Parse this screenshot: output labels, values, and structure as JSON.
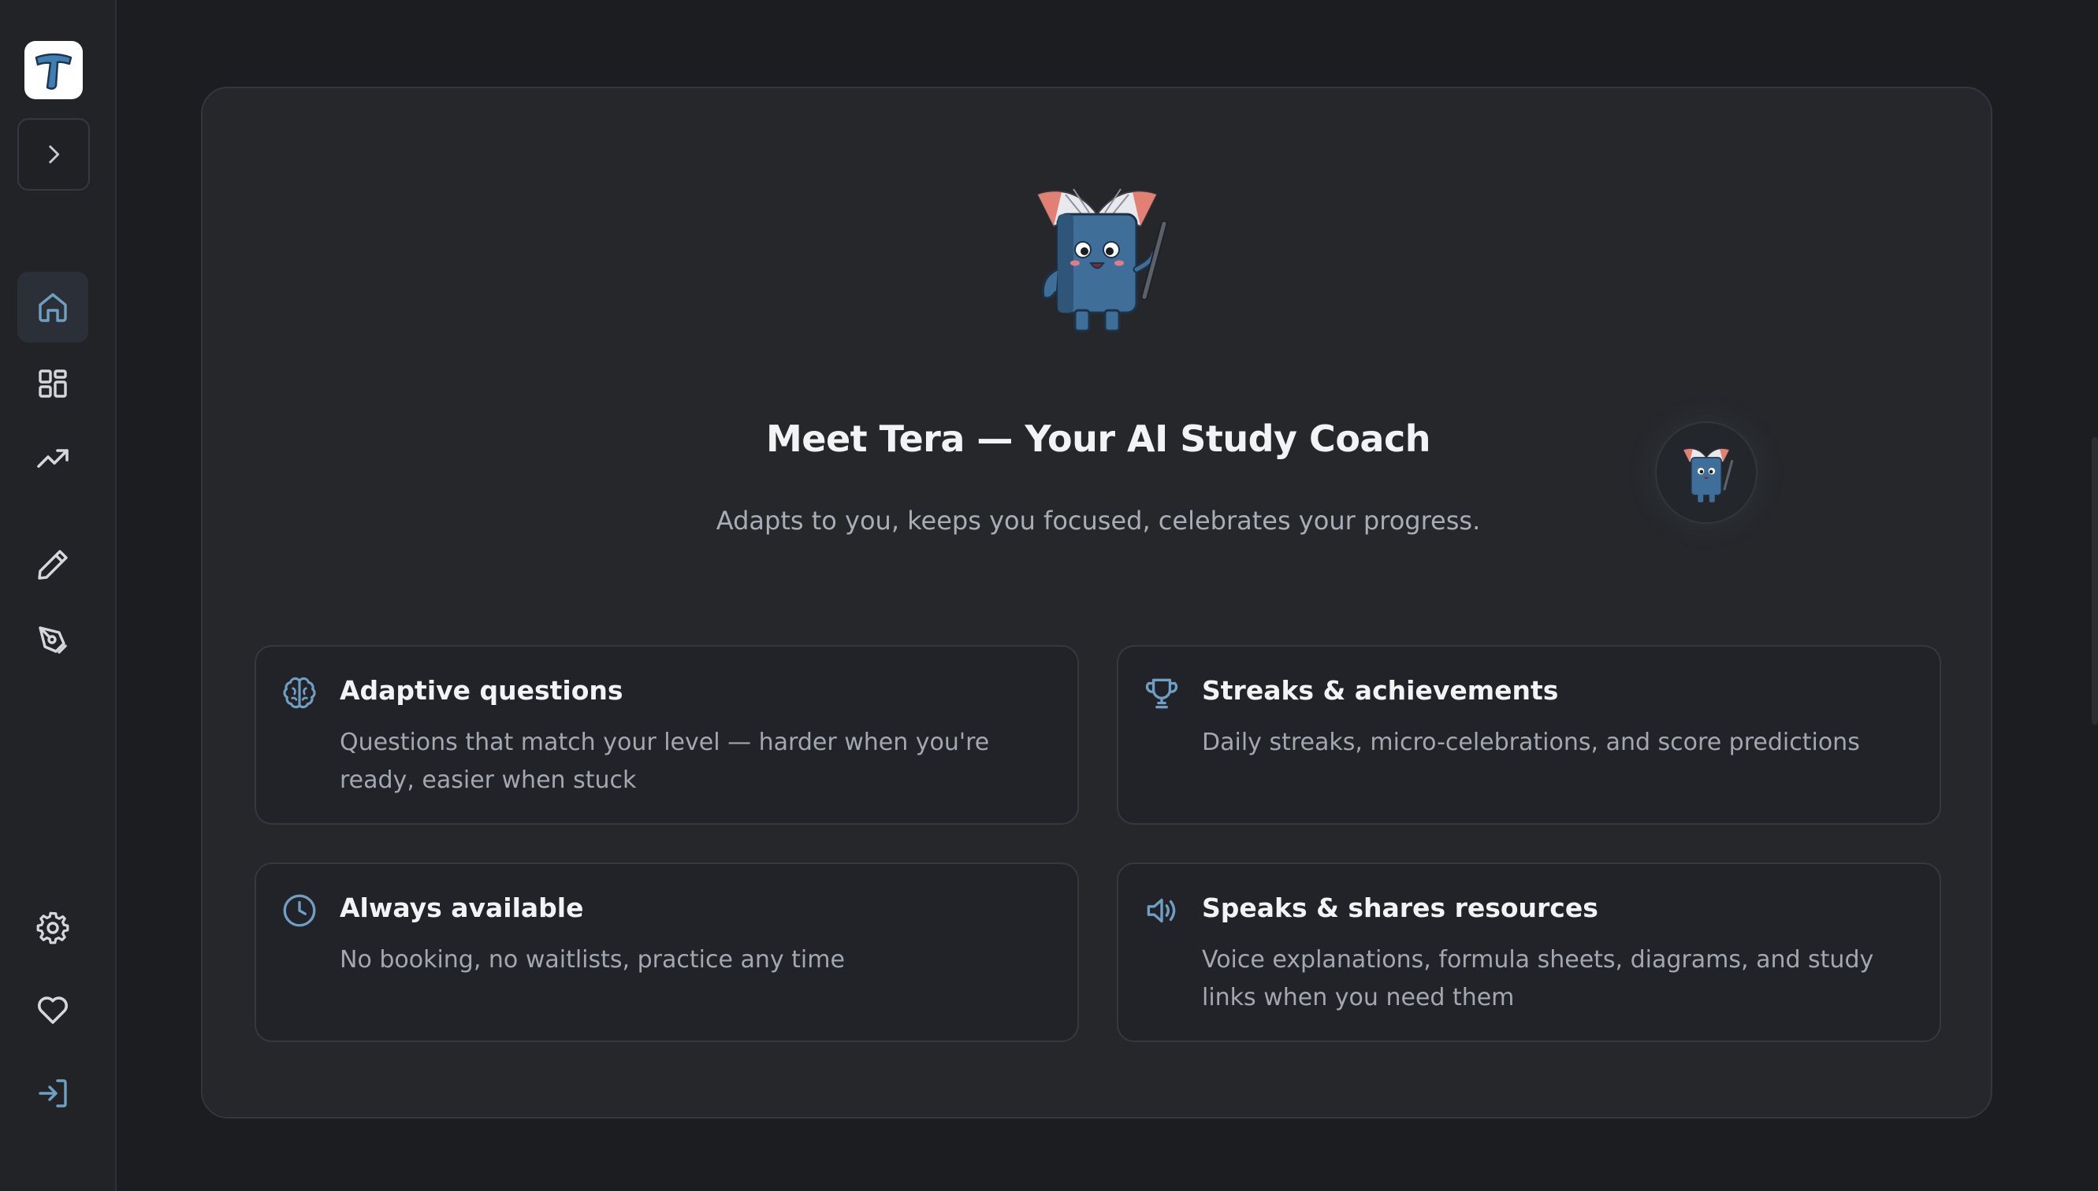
{
  "sidebar": {
    "logo_letter": "T",
    "toggle_icon": "chevron-right-icon",
    "nav": [
      {
        "id": "home",
        "icon": "home-icon",
        "active": true
      },
      {
        "id": "dashboard",
        "icon": "grid-icon",
        "active": false
      },
      {
        "id": "progress",
        "icon": "trending-up-icon",
        "active": false
      },
      {
        "id": "practice",
        "icon": "pencil-icon",
        "active": false
      },
      {
        "id": "write",
        "icon": "pen-tool-icon",
        "active": false
      },
      {
        "id": "settings",
        "icon": "gear-icon",
        "active": false
      },
      {
        "id": "favorites",
        "icon": "heart-icon",
        "active": false
      },
      {
        "id": "login",
        "icon": "log-in-icon",
        "active": false
      }
    ]
  },
  "hero": {
    "title": "Meet Tera — Your AI Study Coach",
    "subtitle": "Adapts to you, keeps you focused, celebrates your progress."
  },
  "features": [
    {
      "icon": "brain-icon",
      "title": "Adaptive questions",
      "description": "Questions that match your level — harder when you're ready, easier when stuck"
    },
    {
      "icon": "trophy-icon",
      "title": "Streaks & achievements",
      "description": "Daily streaks, micro-celebrations, and score predictions"
    },
    {
      "icon": "clock-icon",
      "title": "Always available",
      "description": "No booking, no waitlists, practice any time"
    },
    {
      "icon": "speaker-icon",
      "title": "Speaks & shares resources",
      "description": "Voice explanations, formula sheets, diagrams, and study links when you need them"
    }
  ],
  "colors": {
    "accent": "#6f9fc2",
    "icon_default": "#d4d7dd",
    "background": "#1c1d20",
    "card": "#25272b"
  }
}
